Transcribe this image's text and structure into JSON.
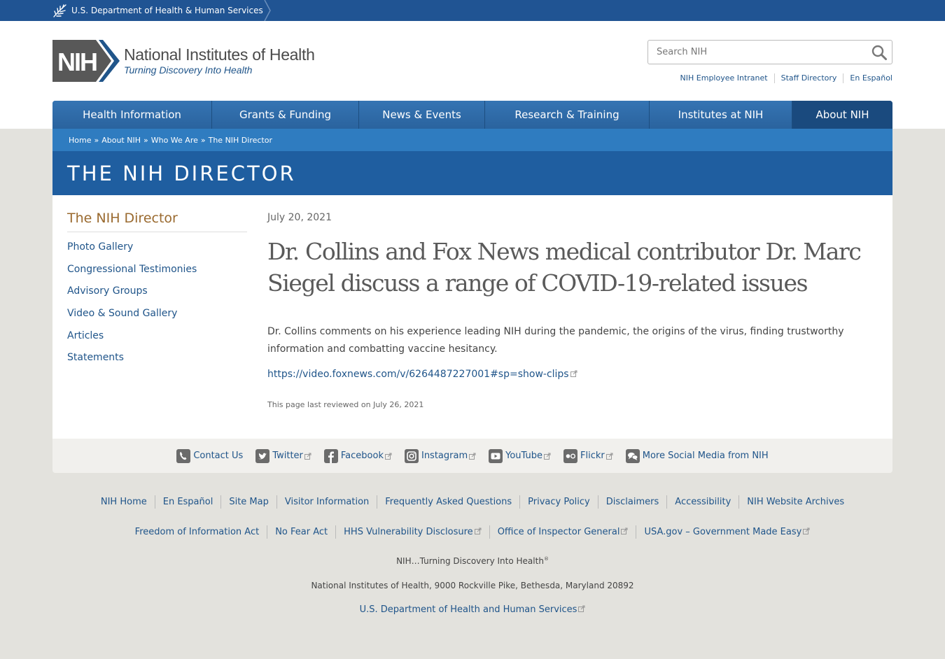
{
  "hhs_bar": {
    "label": "U.S. Department of Health & Human Services"
  },
  "header": {
    "logo_mark": "NIH",
    "logo_title": "National Institutes of Health",
    "logo_tagline": "Turning Discovery Into Health",
    "search_placeholder": "Search NIH",
    "utility_links": [
      "NIH Employee Intranet",
      "Staff Directory",
      "En Español"
    ]
  },
  "nav": {
    "items": [
      "Health Information",
      "Grants & Funding",
      "News & Events",
      "Research & Training",
      "Institutes at NIH",
      "About NIH"
    ],
    "active": "About NIH"
  },
  "breadcrumb": [
    "Home",
    "About NIH",
    "Who We Are",
    "The NIH Director"
  ],
  "breadcrumb_separator": "»",
  "banner": {
    "title": "THE NIH DIRECTOR"
  },
  "sidebar": {
    "title": "The NIH Director",
    "items": [
      "Photo Gallery",
      "Congressional Testimonies",
      "Advisory Groups",
      "Video & Sound Gallery",
      "Articles",
      "Statements"
    ]
  },
  "article": {
    "date": "July 20, 2021",
    "headline": "Dr. Collins and Fox News medical contributor Dr. Marc Siegel discuss a range of COVID-19-related issues",
    "summary": "Dr. Collins comments on his experience leading NIH during the pandemic, the origins of the virus, finding trustworthy information and combatting vaccine hesitancy.",
    "video_link": "https://video.foxnews.com/v/6264487227001#sp=show-clips",
    "last_reviewed": "This page last reviewed on July 26, 2021"
  },
  "social": {
    "items": [
      {
        "label": "Contact Us",
        "icon": "phone-icon",
        "external": false
      },
      {
        "label": "Twitter",
        "icon": "twitter-icon",
        "external": true
      },
      {
        "label": "Facebook",
        "icon": "facebook-icon",
        "external": true
      },
      {
        "label": "Instagram",
        "icon": "instagram-icon",
        "external": true
      },
      {
        "label": "YouTube",
        "icon": "youtube-icon",
        "external": true
      },
      {
        "label": "Flickr",
        "icon": "flickr-icon",
        "external": true
      },
      {
        "label": "More Social Media from NIH",
        "icon": "chat-bubbles-icon",
        "external": false
      }
    ]
  },
  "footer": {
    "row1": [
      "NIH Home",
      "En Español",
      "Site Map",
      "Visitor Information",
      "Frequently Asked Questions",
      "Privacy Policy",
      "Disclaimers",
      "Accessibility",
      "NIH Website Archives"
    ],
    "row2": [
      "Freedom of Information Act",
      "No Fear Act",
      "HHS Vulnerability Disclosure",
      "Office of Inspector General",
      "USA.gov – Government Made Easy"
    ],
    "tagline": "NIH…Turning Discovery Into Health",
    "tagline_mark": "®",
    "address": "National Institutes of Health, 9000 Rockville Pike, Bethesda, Maryland 20892",
    "hhs_link": "U.S. Department of Health and Human Services"
  },
  "colors": {
    "hhs_bar": "#205493",
    "nav": "#2c67a4",
    "nav_active": "#1a4a7e",
    "breadcrumb": "#2f7cc0",
    "banner": "#1f5ea0",
    "link": "#20558a",
    "sidebar_title": "#9a6a2f",
    "page_bg": "#e3e2dd"
  }
}
